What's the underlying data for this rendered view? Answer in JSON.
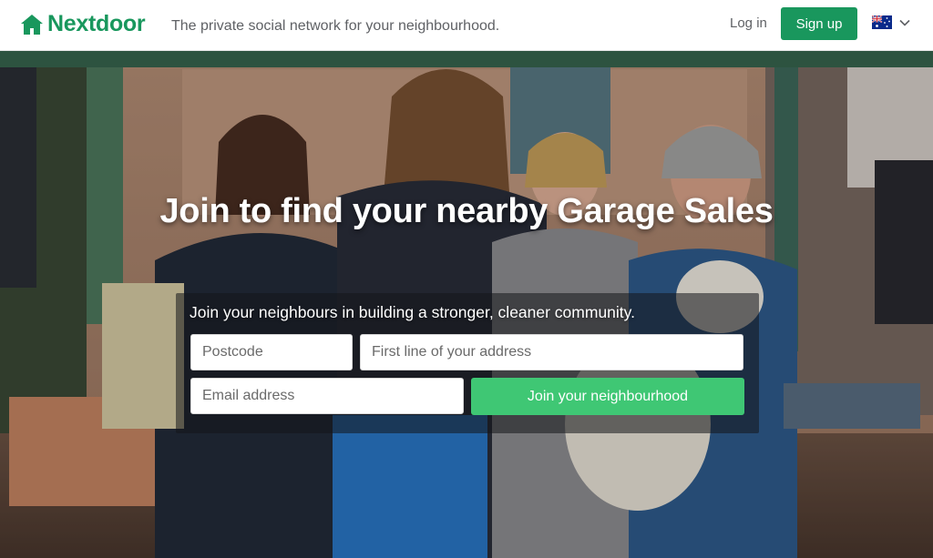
{
  "header": {
    "brand": "Nextdoor",
    "tagline": "The private social network for your neighbourhood.",
    "login_label": "Log in",
    "signup_label": "Sign up",
    "country_icon": "australia-flag-icon",
    "brand_color": "#19975d"
  },
  "hero": {
    "headline": "Join to find your nearby Garage Sales",
    "subhead": "Join your neighbours in building a stronger, cleaner community.",
    "postcode_placeholder": "Postcode",
    "address_placeholder": "First line of your address",
    "email_placeholder": "Email address",
    "join_label": "Join your neighbourhood",
    "join_color": "#3fc774"
  }
}
